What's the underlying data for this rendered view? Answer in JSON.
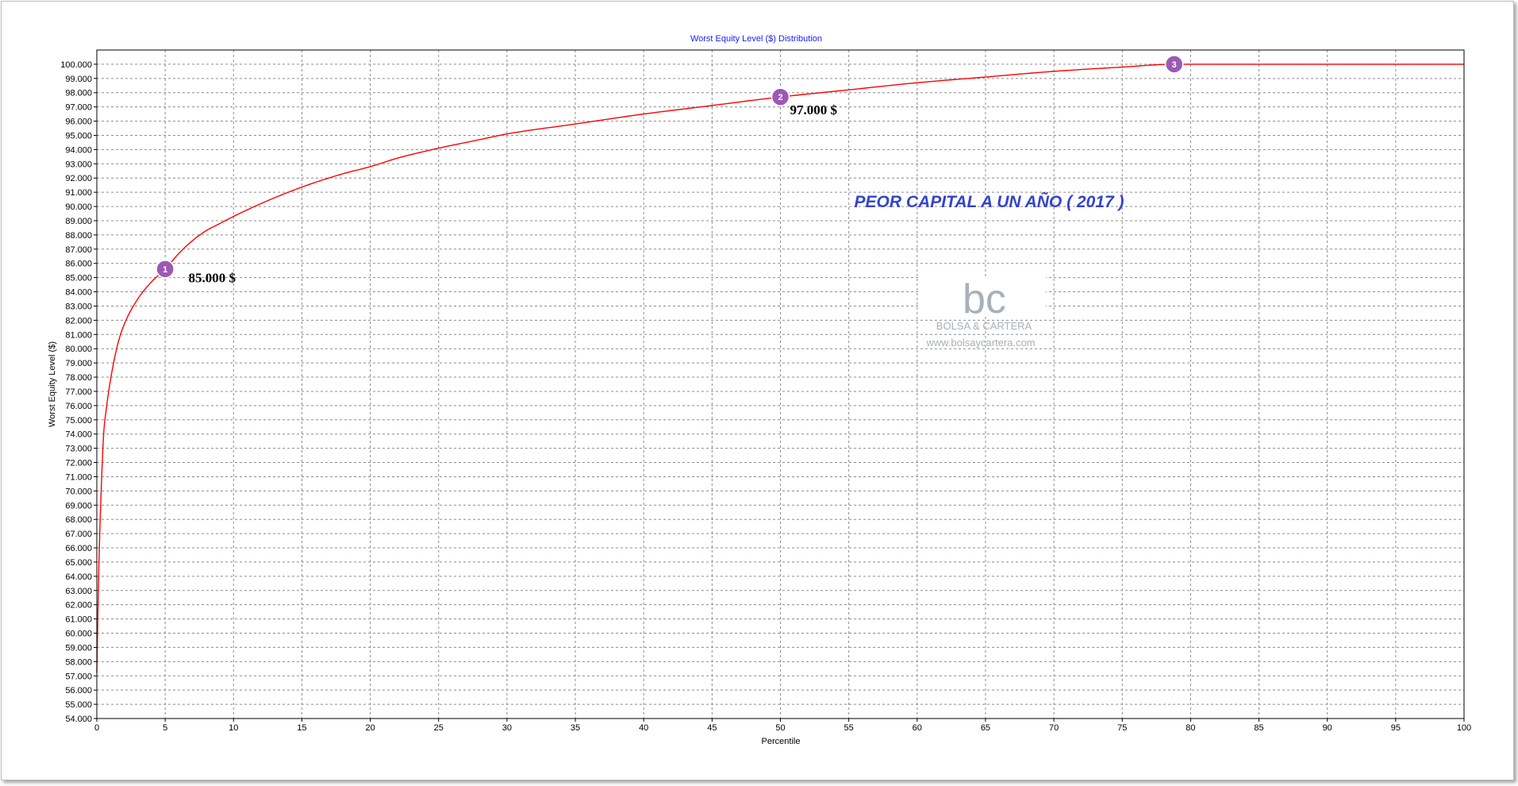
{
  "chart_data": {
    "type": "line",
    "title": "Worst Equity Level ($) Distribution",
    "xlabel": "Percentile",
    "ylabel": "Worst Equity Level ($)",
    "xlim": [
      0,
      100
    ],
    "ylim": [
      54000,
      101000
    ],
    "x_ticks": [
      0,
      5,
      10,
      15,
      20,
      25,
      30,
      35,
      40,
      45,
      50,
      55,
      60,
      65,
      70,
      75,
      80,
      85,
      90,
      95,
      100
    ],
    "y_ticks": [
      54000,
      55000,
      56000,
      57000,
      58000,
      59000,
      60000,
      61000,
      62000,
      63000,
      64000,
      65000,
      66000,
      67000,
      68000,
      69000,
      70000,
      71000,
      72000,
      73000,
      74000,
      75000,
      76000,
      77000,
      78000,
      79000,
      80000,
      81000,
      82000,
      83000,
      84000,
      85000,
      86000,
      87000,
      88000,
      89000,
      90000,
      91000,
      92000,
      93000,
      94000,
      95000,
      96000,
      97000,
      98000,
      99000,
      100000
    ],
    "x_tick_labels": [
      "0",
      "5",
      "10",
      "15",
      "20",
      "25",
      "30",
      "35",
      "40",
      "45",
      "50",
      "55",
      "60",
      "65",
      "70",
      "75",
      "80",
      "85",
      "90",
      "95",
      "100"
    ],
    "y_tick_labels": [
      "54.000",
      "55.000",
      "56.000",
      "57.000",
      "58.000",
      "59.000",
      "60.000",
      "61.000",
      "62.000",
      "63.000",
      "64.000",
      "65.000",
      "66.000",
      "67.000",
      "68.000",
      "69.000",
      "70.000",
      "71.000",
      "72.000",
      "73.000",
      "74.000",
      "75.000",
      "76.000",
      "77.000",
      "78.000",
      "79.000",
      "80.000",
      "81.000",
      "82.000",
      "83.000",
      "84.000",
      "85.000",
      "86.000",
      "87.000",
      "88.000",
      "89.000",
      "90.000",
      "91.000",
      "92.000",
      "93.000",
      "94.000",
      "95.000",
      "96.000",
      "97.000",
      "98.000",
      "99.000",
      "100.000"
    ],
    "grid": true,
    "series": [
      {
        "color": "#ff0000",
        "x": [
          0,
          0.1,
          0.2,
          0.3,
          0.4,
          0.5,
          0.7,
          1,
          1.5,
          2,
          3,
          4,
          5,
          6,
          7,
          8,
          9,
          10,
          12,
          14,
          16,
          18,
          20,
          22,
          25,
          28,
          30,
          35,
          40,
          45,
          50,
          55,
          60,
          65,
          70,
          75,
          78.8,
          80,
          85,
          90,
          95,
          100
        ],
        "y": [
          57200,
          62500,
          66500,
          69500,
          72000,
          74000,
          75800,
          77800,
          80200,
          81700,
          83500,
          84700,
          85600,
          86700,
          87600,
          88300,
          88800,
          89300,
          90200,
          91000,
          91700,
          92300,
          92800,
          93400,
          94100,
          94700,
          95100,
          95800,
          96500,
          97100,
          97700,
          98200,
          98700,
          99100,
          99500,
          99800,
          100000,
          100000,
          100000,
          100000,
          100000,
          100000
        ]
      }
    ],
    "markers": [
      {
        "label": "1",
        "x": 5,
        "y": 85600,
        "color": "#9b59b6"
      },
      {
        "label": "2",
        "x": 50,
        "y": 97700,
        "color": "#9b59b6"
      },
      {
        "label": "3",
        "x": 78.8,
        "y": 100000,
        "color": "#9b59b6"
      }
    ],
    "annotations": [
      {
        "text": "85.000 $",
        "x": 6.7,
        "y": 85000
      },
      {
        "text": "97.000 $",
        "x": 50.7,
        "y": 96800
      }
    ],
    "annotation_note": {
      "text": "PEOR CAPITAL A UN AÑO ( 2017 )",
      "x": 55.4,
      "y": 90400,
      "color": "#3344cc"
    }
  },
  "watermark": {
    "logo_letters": "bc",
    "name": "BOLSA & CARTERA",
    "url": "www.bolsaycartera.com"
  }
}
